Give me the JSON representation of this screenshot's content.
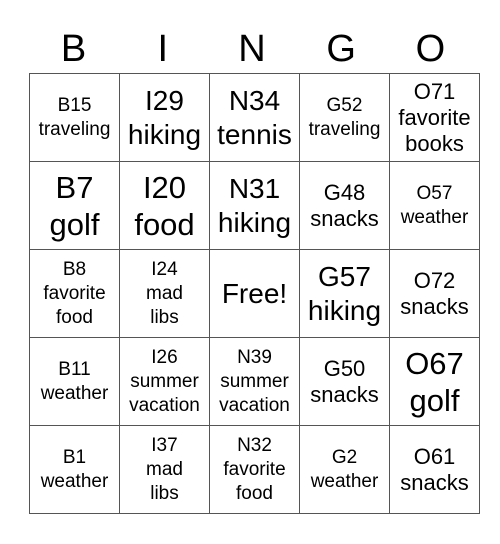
{
  "title_letters": [
    "B",
    "I",
    "N",
    "G",
    "O"
  ],
  "rows": [
    [
      {
        "text": "B15\ntraveling",
        "size": "sm"
      },
      {
        "text": "I29\nhiking",
        "size": "lg"
      },
      {
        "text": "N34\ntennis",
        "size": "lg"
      },
      {
        "text": "G52\ntraveling",
        "size": "sm"
      },
      {
        "text": "O71\nfavorite\nbooks",
        "size": "md"
      }
    ],
    [
      {
        "text": "B7\ngolf",
        "size": "xl"
      },
      {
        "text": "I20\nfood",
        "size": "xl"
      },
      {
        "text": "N31\nhiking",
        "size": "lg"
      },
      {
        "text": "G48\nsnacks",
        "size": "md"
      },
      {
        "text": "O57\nweather",
        "size": "sm"
      }
    ],
    [
      {
        "text": "B8\nfavorite\nfood",
        "size": "sm"
      },
      {
        "text": "I24\nmad\nlibs",
        "size": "sm"
      },
      {
        "text": "Free!",
        "size": "lg"
      },
      {
        "text": "G57\nhiking",
        "size": "lg"
      },
      {
        "text": "O72\nsnacks",
        "size": "md"
      }
    ],
    [
      {
        "text": "B11\nweather",
        "size": "sm"
      },
      {
        "text": "I26\nsummer\nvacation",
        "size": "sm"
      },
      {
        "text": "N39\nsummer\nvacation",
        "size": "sm"
      },
      {
        "text": "G50\nsnacks",
        "size": "md"
      },
      {
        "text": "O67\ngolf",
        "size": "xl"
      }
    ],
    [
      {
        "text": "B1\nweather",
        "size": "sm"
      },
      {
        "text": "I37\nmad\nlibs",
        "size": "sm"
      },
      {
        "text": "N32\nfavorite\nfood",
        "size": "sm"
      },
      {
        "text": "G2\nweather",
        "size": "sm"
      },
      {
        "text": "O61\nsnacks",
        "size": "md"
      }
    ]
  ]
}
